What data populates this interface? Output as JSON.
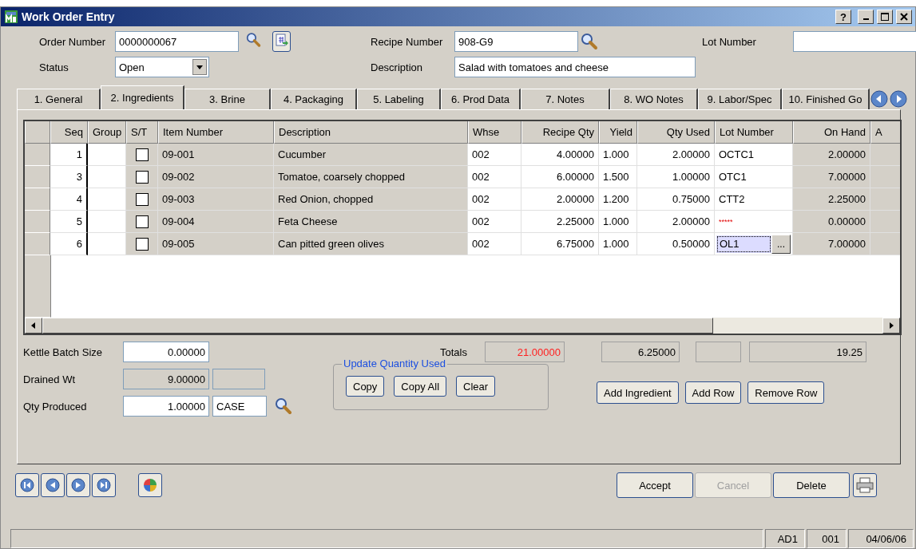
{
  "window": {
    "title": "Work Order Entry",
    "help": "?"
  },
  "header": {
    "order_number": {
      "label": "Order Number",
      "value": "0000000067"
    },
    "status": {
      "label": "Status",
      "value": "Open"
    },
    "recipe_number": {
      "label": "Recipe Number",
      "value": "908-G9"
    },
    "description": {
      "label": "Description",
      "value": "Salad with tomatoes and cheese"
    },
    "lot_number": {
      "label": "Lot Number"
    }
  },
  "tabs": [
    {
      "label": "1. General",
      "selected": false
    },
    {
      "label": "2. Ingredients",
      "selected": true
    },
    {
      "label": "3. Brine",
      "selected": false
    },
    {
      "label": "4. Packaging",
      "selected": false
    },
    {
      "label": "5. Labeling",
      "selected": false
    },
    {
      "label": "6. Prod Data",
      "selected": false
    },
    {
      "label": "7. Notes",
      "selected": false
    },
    {
      "label": "8. WO Notes",
      "selected": false
    },
    {
      "label": "9. Labor/Spec",
      "selected": false
    },
    {
      "label": "10. Finished Go",
      "selected": false
    }
  ],
  "grid": {
    "columns": [
      "Seq",
      "Group",
      "S/T",
      "Item Number",
      "Description",
      "Whse",
      "Recipe Qty",
      "Yield",
      "Qty Used",
      "Lot Number",
      "On Hand",
      "A"
    ],
    "rows": [
      {
        "seq": "1",
        "st_checked": false,
        "item_number": "09-001",
        "description": "Cucumber",
        "whse": "002",
        "recipe_qty": "4.00000",
        "yield": "1.000",
        "qty_used": "2.00000",
        "lot_number": "OCTC1",
        "lot_missing": false,
        "on_hand": "2.00000",
        "focused": false
      },
      {
        "seq": "3",
        "st_checked": false,
        "item_number": "09-002",
        "description": "Tomatoe, coarsely chopped",
        "whse": "002",
        "recipe_qty": "6.00000",
        "yield": "1.500",
        "qty_used": "1.00000",
        "lot_number": "OTC1",
        "lot_missing": false,
        "on_hand": "7.00000",
        "focused": false
      },
      {
        "seq": "4",
        "st_checked": false,
        "item_number": "09-003",
        "description": "Red Onion, chopped",
        "whse": "002",
        "recipe_qty": "2.00000",
        "yield": "1.200",
        "qty_used": "0.75000",
        "lot_number": "CTT2",
        "lot_missing": false,
        "on_hand": "2.25000",
        "focused": false
      },
      {
        "seq": "5",
        "st_checked": false,
        "item_number": "09-004",
        "description": "Feta Cheese",
        "whse": "002",
        "recipe_qty": "2.25000",
        "yield": "1.000",
        "qty_used": "2.00000",
        "lot_number": "*****",
        "lot_missing": true,
        "on_hand": "0.00000",
        "focused": false
      },
      {
        "seq": "6",
        "st_checked": false,
        "item_number": "09-005",
        "description": "Can pitted green olives",
        "whse": "002",
        "recipe_qty": "6.75000",
        "yield": "1.000",
        "qty_used": "0.50000",
        "lot_number": "OL1",
        "lot_missing": false,
        "on_hand": "7.00000",
        "focused": true,
        "lookup": "..."
      }
    ]
  },
  "kettle_batch_size": {
    "label": "Kettle Batch Size",
    "value": "0.00000"
  },
  "drained_wt": {
    "label": "Drained Wt",
    "value": "9.00000"
  },
  "qty_produced": {
    "label": "Qty Produced",
    "value": "1.00000",
    "unit": "CASE"
  },
  "totals": {
    "label": "Totals",
    "boxes": [
      {
        "value": "21.00000",
        "warning": true
      },
      {
        "value": "6.25000",
        "warning": false
      },
      {
        "value": "19.25",
        "warning": false
      }
    ]
  },
  "update_quantity_used": {
    "title": "Update Quantity Used",
    "buttons": [
      "Copy",
      "Copy All",
      "Clear"
    ]
  },
  "row_buttons": [
    "Add Ingredient",
    "Add Row",
    "Remove Row"
  ],
  "footer_buttons": [
    {
      "label": "Accept",
      "disabled": false
    },
    {
      "label": "Cancel",
      "disabled": true
    },
    {
      "label": "Delete",
      "disabled": false
    }
  ],
  "status_bar": [
    "AD1",
    "001",
    "04/06/06"
  ]
}
